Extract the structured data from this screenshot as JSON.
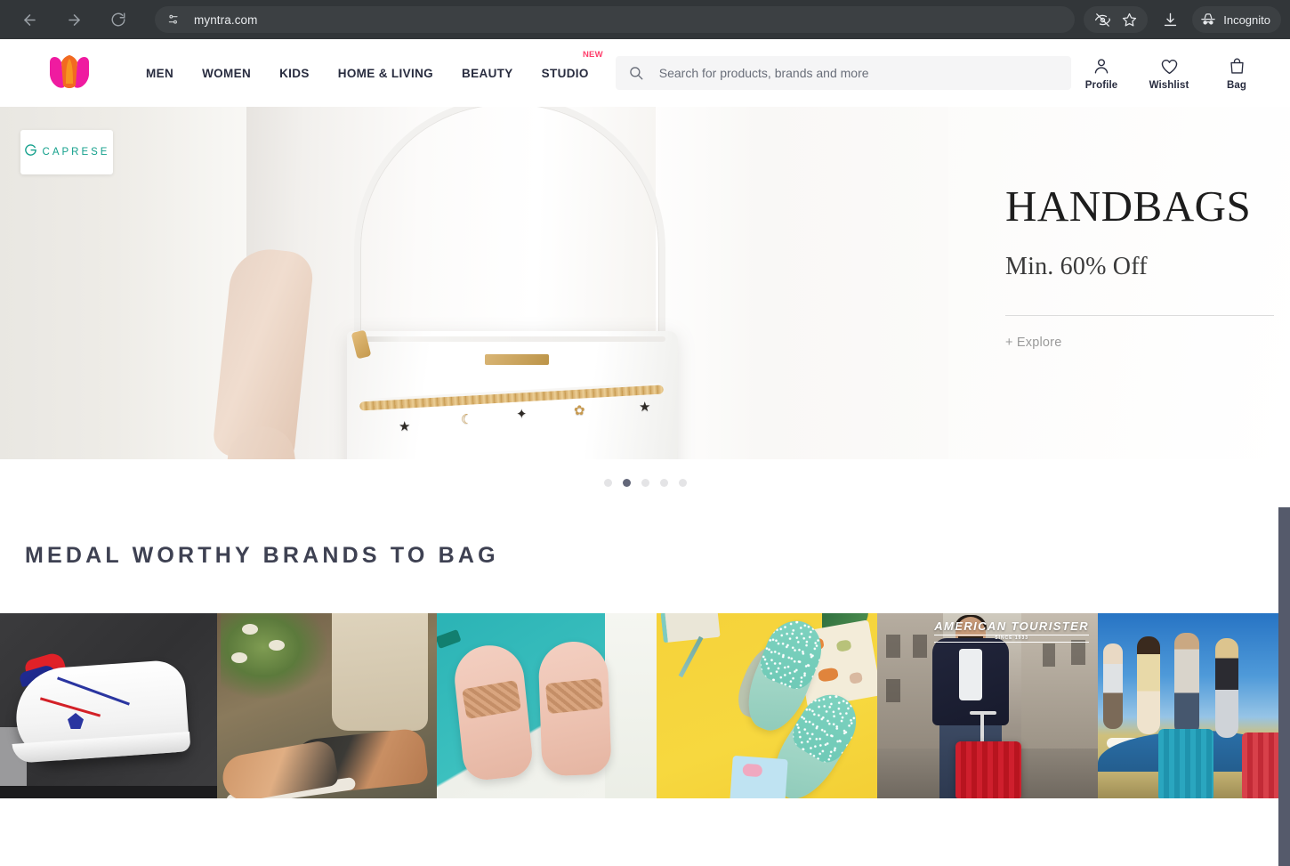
{
  "browser": {
    "url": "myntra.com",
    "back_icon": "back-arrow-icon",
    "forward_icon": "forward-arrow-icon",
    "reload_icon": "reload-icon",
    "site_settings_icon": "site-settings-icon",
    "tracking_icon": "tracking-protection-icon",
    "bookmark_icon": "star-bookmark-icon",
    "download_icon": "download-icon",
    "incognito_label": "Incognito",
    "incognito_icon": "incognito-icon"
  },
  "header": {
    "logo_name": "myntra-logo",
    "nav": [
      {
        "label": "MEN"
      },
      {
        "label": "WOMEN"
      },
      {
        "label": "KIDS"
      },
      {
        "label": "HOME & LIVING"
      },
      {
        "label": "BEAUTY"
      },
      {
        "label": "STUDIO",
        "badge": "NEW"
      }
    ],
    "search": {
      "placeholder": "Search for products, brands and more",
      "value": "",
      "icon": "search-icon"
    },
    "actions": [
      {
        "label": "Profile",
        "icon": "user-icon"
      },
      {
        "label": "Wishlist",
        "icon": "heart-icon"
      },
      {
        "label": "Bag",
        "icon": "bag-icon"
      }
    ]
  },
  "hero": {
    "brand_badge": "CAPRESE",
    "brand_badge_icon": "caprese-circle-icon",
    "brand_color": "#14a08c",
    "title": "HANDBAGS",
    "subtitle": "Min. 60% Off",
    "cta": "+ Explore",
    "carousel": {
      "total": 5,
      "active_index": 1
    }
  },
  "brands_section": {
    "title": "MEDAL WORTHY BRANDS TO BAG",
    "title_color": "#3e4152",
    "cards": [
      {
        "name": "us-polo-assn-sneaker-card"
      },
      {
        "name": "rose-gold-sneakers-card"
      },
      {
        "name": "metro-pink-sandals-card"
      },
      {
        "name": "glitter-mules-card"
      },
      {
        "name": "american-tourister-card",
        "logo": "AMERICAN TOURISTER",
        "since": "SINCE 1933"
      },
      {
        "name": "travel-luggage-card"
      }
    ]
  },
  "scrollbar": {
    "name": "page-scrollbar"
  }
}
